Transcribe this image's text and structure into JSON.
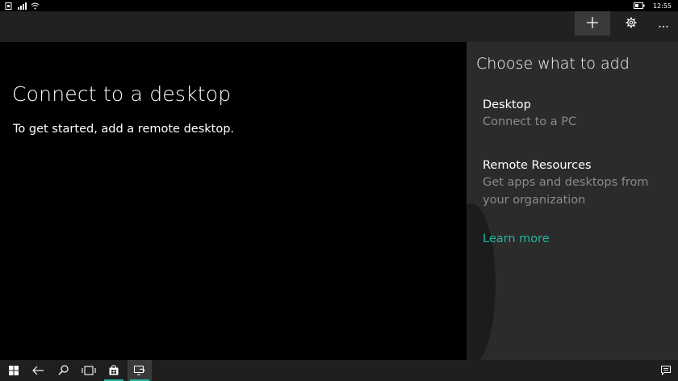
{
  "status_bar": {
    "time": "12:55",
    "icons": [
      "sim-icon",
      "signal-icon",
      "wifi-icon",
      "battery-icon"
    ]
  },
  "app_bar": {
    "buttons": [
      "add-icon",
      "settings-icon",
      "more-icon"
    ]
  },
  "main": {
    "title": "Connect to a desktop",
    "subtitle": "To get started, add a remote desktop."
  },
  "flyout": {
    "title": "Choose what to add",
    "items": [
      {
        "title": "Desktop",
        "description": "Connect to a PC"
      },
      {
        "title": "Remote Resources",
        "description_line1": "Get apps and desktops from",
        "description_line2": "your organization"
      }
    ],
    "learn_more": "Learn more"
  },
  "taskbar": {
    "items": [
      "windows-start-icon",
      "back-icon",
      "search-icon",
      "task-view-icon",
      "store-icon",
      "remote-desktop-app-icon"
    ],
    "right": [
      "action-center-icon"
    ]
  },
  "colors": {
    "accent": "#1fb8a0",
    "flyout_bg": "#2b2b2b",
    "appbar_bg": "#212121",
    "secondary_text": "#8a8a8a"
  }
}
